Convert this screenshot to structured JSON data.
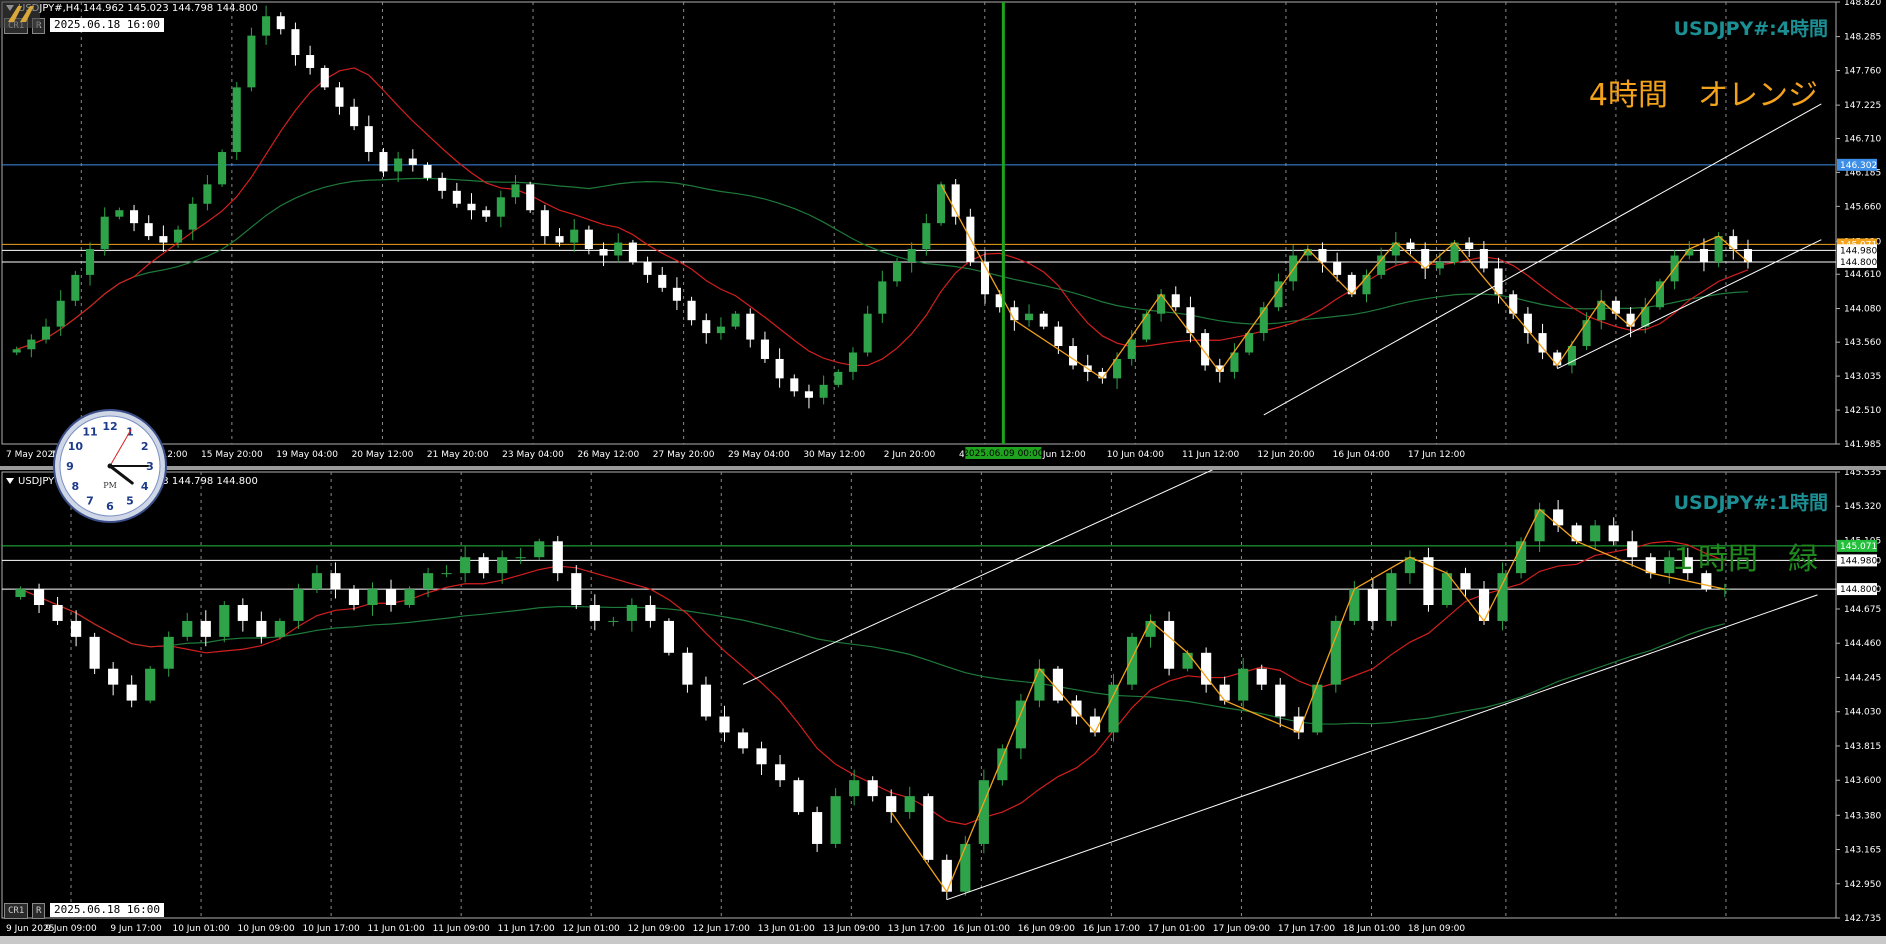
{
  "panes": {
    "top": {
      "symbol_line": "USDJPY#,H4  144.962 145.023 144.798 144.800",
      "cr_label": "CR1",
      "r_label": "R",
      "datetime_label": "2025.06.18 16:00",
      "title": "USDJPY#:4時間",
      "note": "4時間　オレンジ",
      "highlight_date": "2025.06.09 00:00"
    },
    "bottom": {
      "symbol_line": "USDJPY#,H1  144.962 145.023 144.798 144.800",
      "cr_label": "CR1",
      "r_label": "R",
      "datetime_label": "2025.06.18 16:00",
      "title": "USDJPY#:1時間",
      "note": "１時間　緑"
    }
  },
  "clock": {
    "am_pm": "PM",
    "numbers": [
      "12",
      "1",
      "2",
      "3",
      "4",
      "5",
      "6",
      "7",
      "8",
      "9",
      "10",
      "11"
    ],
    "hour": 4,
    "minute": 15
  },
  "colors": {
    "bull": "#2fa34a",
    "bear": "#ffffff",
    "ma_fast": "#d41f1f",
    "ma_slow": "#1e7a3a",
    "zigzag": "#f3a21b",
    "channel": "#ffffff",
    "level_orange": "#f3a21b",
    "level_white": "#ffffff",
    "level_blue": "#3c8ee6",
    "level_green": "#24c03c",
    "title_teal": "#1b8f94",
    "note_orange": "#f3a21b",
    "note_green": "#1e8a1e"
  },
  "chart_data": [
    {
      "type": "candlestick",
      "title": "USDJPY#:4時間",
      "ylim": [
        141.985,
        148.82
      ],
      "y_ticks": [
        "148.820",
        "148.285",
        "147.760",
        "147.225",
        "146.710",
        "146.185",
        "145.660",
        "145.120",
        "144.610",
        "144.080",
        "143.560",
        "143.035",
        "142.510",
        "141.985"
      ],
      "x_ticks": [
        "7 May 2025",
        "13 May 04:00",
        "14 May 12:00",
        "15 May 20:00",
        "19 May 04:00",
        "20 May 12:00",
        "21 May 20:00",
        "23 May 04:00",
        "26 May 12:00",
        "27 May 20:00",
        "29 May 04:00",
        "30 May 12:00",
        "2 Jun 20:00",
        "4 Jun 04:00",
        "5 Jun 12:00",
        "10 Jun 04:00",
        "11 Jun 12:00",
        "12 Jun 20:00",
        "16 Jun 04:00",
        "17 Jun 12:00"
      ],
      "price_labels": [
        {
          "value": 146.302,
          "text": "146.302",
          "color": "#3c8ee6"
        },
        {
          "value": 145.071,
          "text": "145.071",
          "color": "#f3a21b"
        },
        {
          "value": 144.98,
          "text": "144.980",
          "color": "#ffffff"
        },
        {
          "value": 144.8,
          "text": "144.800",
          "color": "#ffffff"
        }
      ],
      "close": [
        143.45,
        143.6,
        143.8,
        144.2,
        144.6,
        145.0,
        145.5,
        145.6,
        145.4,
        145.2,
        145.1,
        145.3,
        145.7,
        146.0,
        146.5,
        147.5,
        148.3,
        148.6,
        148.4,
        148.0,
        147.8,
        147.5,
        147.2,
        146.9,
        146.5,
        146.2,
        146.4,
        146.3,
        146.1,
        145.9,
        145.7,
        145.6,
        145.5,
        145.8,
        146.0,
        145.6,
        145.2,
        145.1,
        145.3,
        145.0,
        144.9,
        145.1,
        144.8,
        144.6,
        144.4,
        144.2,
        143.9,
        143.7,
        143.8,
        144.0,
        143.6,
        143.3,
        143.0,
        142.8,
        142.7,
        142.9,
        143.1,
        143.4,
        144.0,
        144.5,
        144.8,
        145.0,
        145.4,
        146.0,
        145.5,
        144.8,
        144.3,
        144.1,
        143.9,
        144.0,
        143.8,
        143.5,
        143.2,
        143.1,
        143.0,
        143.3,
        143.6,
        144.0,
        144.3,
        144.1,
        143.7,
        143.2,
        143.1,
        143.4,
        143.7,
        144.1,
        144.5,
        144.9,
        145.0,
        144.8,
        144.6,
        144.3,
        144.6,
        144.9,
        145.1,
        145.0,
        144.7,
        144.8,
        145.1,
        145.0,
        144.7,
        144.3,
        144.0,
        143.7,
        143.4,
        143.2,
        143.5,
        143.9,
        144.2,
        144.0,
        143.8,
        144.1,
        144.5,
        144.9,
        145.0,
        144.8,
        145.2,
        145.0,
        144.8
      ]
    },
    {
      "type": "candlestick",
      "title": "USDJPY#:1時間",
      "ylim": [
        142.735,
        145.535
      ],
      "y_ticks": [
        "145.535",
        "145.320",
        "145.105",
        "144.980",
        "144.800",
        "144.675",
        "144.460",
        "144.245",
        "144.030",
        "143.815",
        "143.600",
        "143.380",
        "143.165",
        "142.950",
        "142.735"
      ],
      "x_ticks": [
        "9 Jun 2025",
        "9 Jun 09:00",
        "9 Jun 17:00",
        "10 Jun 01:00",
        "10 Jun 09:00",
        "10 Jun 17:00",
        "11 Jun 01:00",
        "11 Jun 09:00",
        "11 Jun 17:00",
        "12 Jun 01:00",
        "12 Jun 09:00",
        "12 Jun 17:00",
        "13 Jun 01:00",
        "13 Jun 09:00",
        "13 Jun 17:00",
        "16 Jun 01:00",
        "16 Jun 09:00",
        "16 Jun 17:00",
        "17 Jun 01:00",
        "17 Jun 09:00",
        "17 Jun 17:00",
        "18 Jun 01:00",
        "18 Jun 09:00"
      ],
      "price_labels": [
        {
          "value": 145.071,
          "text": "145.071",
          "color": "#24c03c"
        },
        {
          "value": 144.98,
          "text": "144.980",
          "color": "#ffffff"
        },
        {
          "value": 144.8,
          "text": "144.800",
          "color": "#ffffff"
        }
      ],
      "close": [
        144.8,
        144.7,
        144.6,
        144.5,
        144.3,
        144.2,
        144.1,
        144.3,
        144.5,
        144.6,
        144.5,
        144.7,
        144.6,
        144.5,
        144.6,
        144.8,
        144.9,
        144.8,
        144.7,
        144.8,
        144.7,
        144.8,
        144.9,
        144.9,
        145.0,
        144.9,
        145.0,
        145.0,
        145.1,
        144.9,
        144.7,
        144.6,
        144.6,
        144.7,
        144.6,
        144.4,
        144.2,
        144.0,
        143.9,
        143.8,
        143.7,
        143.6,
        143.4,
        143.2,
        143.5,
        143.6,
        143.5,
        143.4,
        143.5,
        143.1,
        142.9,
        143.2,
        143.6,
        143.8,
        144.1,
        144.3,
        144.1,
        144.0,
        143.9,
        144.2,
        144.5,
        144.6,
        144.3,
        144.4,
        144.2,
        144.1,
        144.3,
        144.2,
        144.0,
        143.9,
        144.2,
        144.6,
        144.8,
        144.6,
        144.9,
        145.0,
        144.7,
        144.9,
        144.8,
        144.6,
        144.9,
        145.1,
        145.3,
        145.2,
        145.1,
        145.2,
        145.1,
        145.0,
        144.9,
        145.0,
        144.9,
        144.8,
        144.8
      ]
    }
  ]
}
